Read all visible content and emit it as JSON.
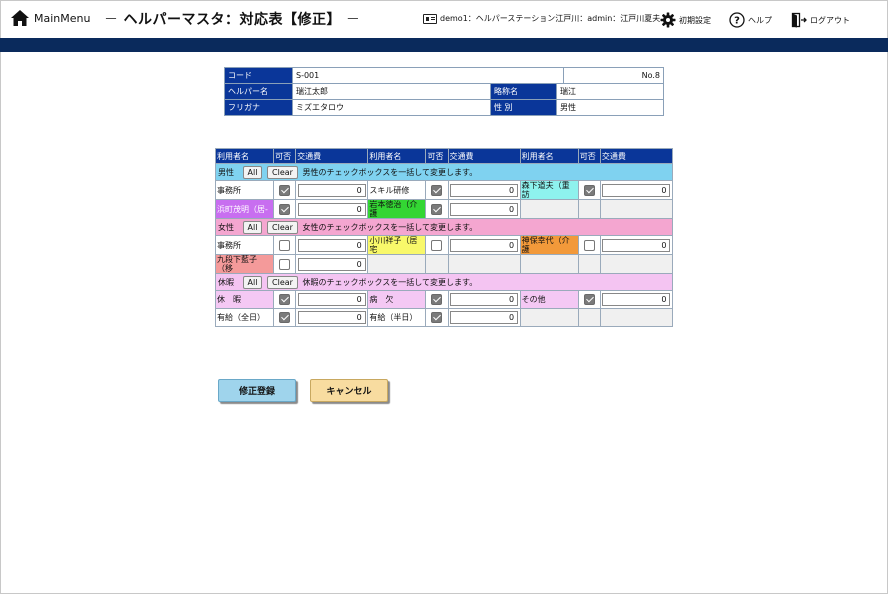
{
  "header": {
    "home_label": "MainMenu",
    "title": "ヘルパーマスタ：対応表【修正】",
    "user_info": "demo1：ヘルパーステーション江戸川：admin：江戸川夏夫",
    "settings_label": "初期設定",
    "help_label": "ヘルプ",
    "logout_label": "ログアウト"
  },
  "info": {
    "code_label": "コード",
    "code_value": "S-001",
    "number": "No.8",
    "name_label": "ヘルパー名",
    "name_value": "瑞江太郎",
    "abbr_label": "略称名",
    "abbr_value": "瑞江",
    "kana_label": "フリガナ",
    "kana_value": "ミズエタロウ",
    "gender_label": "性 別",
    "gender_value": "男性"
  },
  "grid": {
    "headers": [
      "利用者名",
      "可否",
      "交通費",
      "利用者名",
      "可否",
      "交通費",
      "利用者名",
      "可否",
      "交通費"
    ],
    "all_label": "All",
    "clear_label": "Clear",
    "groups": {
      "male": {
        "label": "男性",
        "note": "男性のチェックボックスを一括して変更します。",
        "rows": [
          [
            {
              "name": "事務所",
              "checked": true,
              "amount": "0"
            },
            {
              "name": "スキル研修",
              "checked": true,
              "amount": "0"
            },
            {
              "name": "森下道夫（重訪",
              "checked": true,
              "amount": "0"
            }
          ],
          [
            {
              "name": "浜町茂明（居-",
              "checked": true,
              "amount": "0"
            },
            {
              "name": "岩本徳治（介護",
              "checked": true,
              "amount": "0"
            }
          ]
        ]
      },
      "female": {
        "label": "女性",
        "note": "女性のチェックボックスを一括して変更します。",
        "rows": [
          [
            {
              "name": "事務所",
              "checked": false,
              "amount": "0"
            },
            {
              "name": "小川祥子（居宅",
              "checked": false,
              "amount": "0"
            },
            {
              "name": "神保幸代（介護",
              "checked": false,
              "amount": "0"
            }
          ],
          [
            {
              "name": "九段下藍子（移",
              "checked": false,
              "amount": "0"
            }
          ]
        ]
      },
      "leave": {
        "label": "休暇",
        "note": "休暇のチェックボックスを一括して変更します。",
        "rows": [
          [
            {
              "name": "休　暇",
              "checked": true,
              "amount": "0"
            },
            {
              "name": "病　欠",
              "checked": true,
              "amount": "0"
            },
            {
              "name": "その他",
              "checked": true,
              "amount": "0"
            }
          ],
          [
            {
              "name": "有給（全日）",
              "checked": true,
              "amount": "0"
            },
            {
              "name": "有給（半日）",
              "checked": true,
              "amount": "0"
            }
          ]
        ]
      }
    }
  },
  "buttons": {
    "save_label": "修正登録",
    "cancel_label": "キャンセル"
  },
  "colors": {
    "header_bar": "#0a2a5c",
    "table_header": "#0a3699",
    "male_group": "#7fd2f0",
    "female_group": "#f4a6d0",
    "leave_group": "#f4c4f2",
    "save_button": "#9fd4ec",
    "cancel_button": "#f8dca0"
  }
}
